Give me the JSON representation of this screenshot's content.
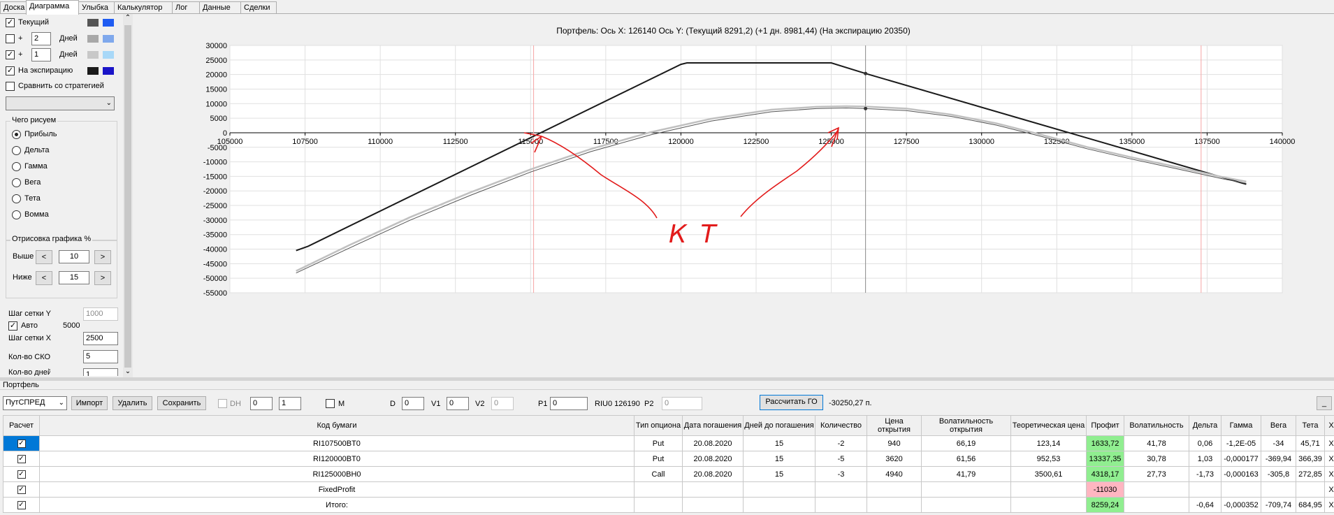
{
  "tabs": [
    "Доска",
    "Диаграмма",
    "Улыбка",
    "Калькулятор",
    "Лог",
    "Данные",
    "Сделки"
  ],
  "active_tab": "Диаграмма",
  "left": {
    "current_label": "Текущий",
    "plus_label": "+",
    "days_label": "Дней",
    "days1": "2",
    "days2": "1",
    "expiry_label": "На экспирацию",
    "compare_label": "Сравнить со стратегией",
    "what_title": "Чего рисуем",
    "options": [
      "Прибыль",
      "Дельта",
      "Гамма",
      "Вега",
      "Тета",
      "Вомма"
    ],
    "draw_title": "Отрисовка графика %",
    "above_label": "Выше",
    "above_value": "10",
    "below_label": "Ниже",
    "below_value": "15",
    "left_arrow": "<",
    "right_arrow": ">",
    "grid_y_label": "Шаг сетки Y",
    "grid_y_value": "1000",
    "auto_label": "Авто",
    "auto_value": "5000",
    "grid_x_label": "Шаг сетки X",
    "grid_x_value": "2500",
    "sko_label": "Кол-во СКО",
    "sko_value": "5",
    "ndays_label": "Кол-во дней",
    "ndays_value": "1",
    "colors": {
      "current": [
        "#555555",
        "#1f5cf2"
      ],
      "days2": [
        "#a8a8a8",
        "#7fa8ec"
      ],
      "days1": [
        "#c8c8c8",
        "#a8d8f8"
      ],
      "expiry": [
        "#1a1a1a",
        "#1a14c8"
      ]
    }
  },
  "chart_header": "Портфель: Ось X: 126140 Ось Y:  (Текущий 8291,2)  (+1 дн. 8981,44)  (На экспирацию 20350)",
  "chart_data": {
    "type": "line",
    "xlim": [
      105000,
      140000
    ],
    "ylim": [
      -55000,
      30000
    ],
    "x_ticks": [
      105000,
      107500,
      110000,
      112500,
      115000,
      117500,
      120000,
      122500,
      125000,
      127500,
      130000,
      132500,
      135000,
      137500,
      140000
    ],
    "y_ticks": [
      30000,
      25000,
      20000,
      15000,
      10000,
      5000,
      0,
      -5000,
      -10000,
      -15000,
      -20000,
      -25000,
      -30000,
      -35000,
      -40000,
      -45000,
      -50000,
      -55000
    ],
    "current_x": 126140,
    "sko_lines": [
      115100,
      137300
    ],
    "series": [
      {
        "color": "#1a1a1a",
        "width": 2,
        "points": [
          [
            107200,
            -40500
          ],
          [
            107600,
            -39000
          ],
          [
            120000,
            23500
          ],
          [
            120200,
            24000
          ],
          [
            125000,
            24000
          ],
          [
            126140,
            20350
          ],
          [
            138800,
            -17700
          ]
        ]
      },
      {
        "color": "#c0c0c0",
        "width": 2.5,
        "points": [
          [
            107200,
            -47500
          ],
          [
            109000,
            -38500
          ],
          [
            111000,
            -29000
          ],
          [
            113000,
            -20500
          ],
          [
            115000,
            -12600
          ],
          [
            117000,
            -5600
          ],
          [
            119000,
            200
          ],
          [
            121000,
            4800
          ],
          [
            123000,
            7900
          ],
          [
            124500,
            8900
          ],
          [
            125500,
            9100
          ],
          [
            126140,
            8990
          ],
          [
            127500,
            8300
          ],
          [
            129000,
            6200
          ],
          [
            130500,
            3200
          ],
          [
            132000,
            -700
          ],
          [
            133500,
            -4900
          ],
          [
            135000,
            -8500
          ],
          [
            136500,
            -11800
          ],
          [
            138000,
            -15200
          ],
          [
            138800,
            -16800
          ]
        ]
      },
      {
        "color": "#555555",
        "width": 1,
        "points": [
          [
            107200,
            -48200
          ],
          [
            109000,
            -39500
          ],
          [
            111000,
            -30000
          ],
          [
            113000,
            -21500
          ],
          [
            115000,
            -13500
          ],
          [
            117000,
            -6500
          ],
          [
            119000,
            -700
          ],
          [
            121000,
            4000
          ],
          [
            123000,
            7200
          ],
          [
            124500,
            8300
          ],
          [
            125500,
            8500
          ],
          [
            126140,
            8290
          ],
          [
            127500,
            7600
          ],
          [
            129000,
            5600
          ],
          [
            130500,
            2600
          ],
          [
            132000,
            -1300
          ],
          [
            133500,
            -5500
          ],
          [
            135000,
            -9100
          ],
          [
            136500,
            -12400
          ],
          [
            138000,
            -15800
          ],
          [
            138800,
            -17400
          ]
        ]
      }
    ],
    "markers": [
      [
        126140,
        20350
      ],
      [
        126140,
        8290
      ]
    ],
    "annotation_text": "КТ"
  },
  "portfolio": {
    "title": "Портфель",
    "strategy": "ПутСПРЕД",
    "import_btn": "Импорт",
    "delete_btn": "Удалить",
    "save_btn": "Сохранить",
    "dh_label": "DH",
    "dh1": "0",
    "dh2": "1",
    "m_label": "M",
    "d_label": "D",
    "d_value": "0",
    "v1_label": "V1",
    "v1_value": "0",
    "v2_label": "V2",
    "v2_value": "0",
    "p1_label": "P1",
    "p1_value": "0",
    "riu_text": "RIU0 126190",
    "p2_label": "P2",
    "p2_value": "0",
    "go_btn": "Рассчитать ГО",
    "go_result": "-30250,27 п.",
    "min_btn": "_",
    "columns": [
      "Расчет",
      "Код бумаги",
      "Тип опциона",
      "Дата погашения",
      "Дней до погашения",
      "Количество",
      "Цена открытия",
      "Волатильность открытия",
      "Теоретическая цена",
      "Профит",
      "Волатильность",
      "Дельта",
      "Гамма",
      "Вега",
      "Тета",
      "X"
    ],
    "rows": [
      [
        "",
        "RI107500BT0",
        "Put",
        "20.08.2020",
        "15",
        "-2",
        "940",
        "66,19",
        "123,14",
        "1633,72",
        "41,78",
        "0,06",
        "-1,2E-05",
        "-34",
        "45,71",
        "X"
      ],
      [
        "",
        "RI120000BT0",
        "Put",
        "20.08.2020",
        "15",
        "-5",
        "3620",
        "61,56",
        "952,53",
        "13337,35",
        "30,78",
        "1,03",
        "-0,000177",
        "-369,94",
        "366,39",
        "X"
      ],
      [
        "",
        "RI125000BH0",
        "Call",
        "20.08.2020",
        "15",
        "-3",
        "4940",
        "41,79",
        "3500,61",
        "4318,17",
        "27,73",
        "-1,73",
        "-0,000163",
        "-305,8",
        "272,85",
        "X"
      ],
      [
        "",
        "FixedProfit",
        "",
        "",
        "",
        "",
        "",
        "",
        "",
        "-11030",
        "",
        "",
        "",
        "",
        "",
        "X"
      ],
      [
        "",
        "Итого:",
        "",
        "",
        "",
        "",
        "",
        "",
        "",
        "8259,24",
        "",
        "-0,64",
        "-0,000352",
        "-709,74",
        "684,95",
        "X"
      ]
    ]
  }
}
